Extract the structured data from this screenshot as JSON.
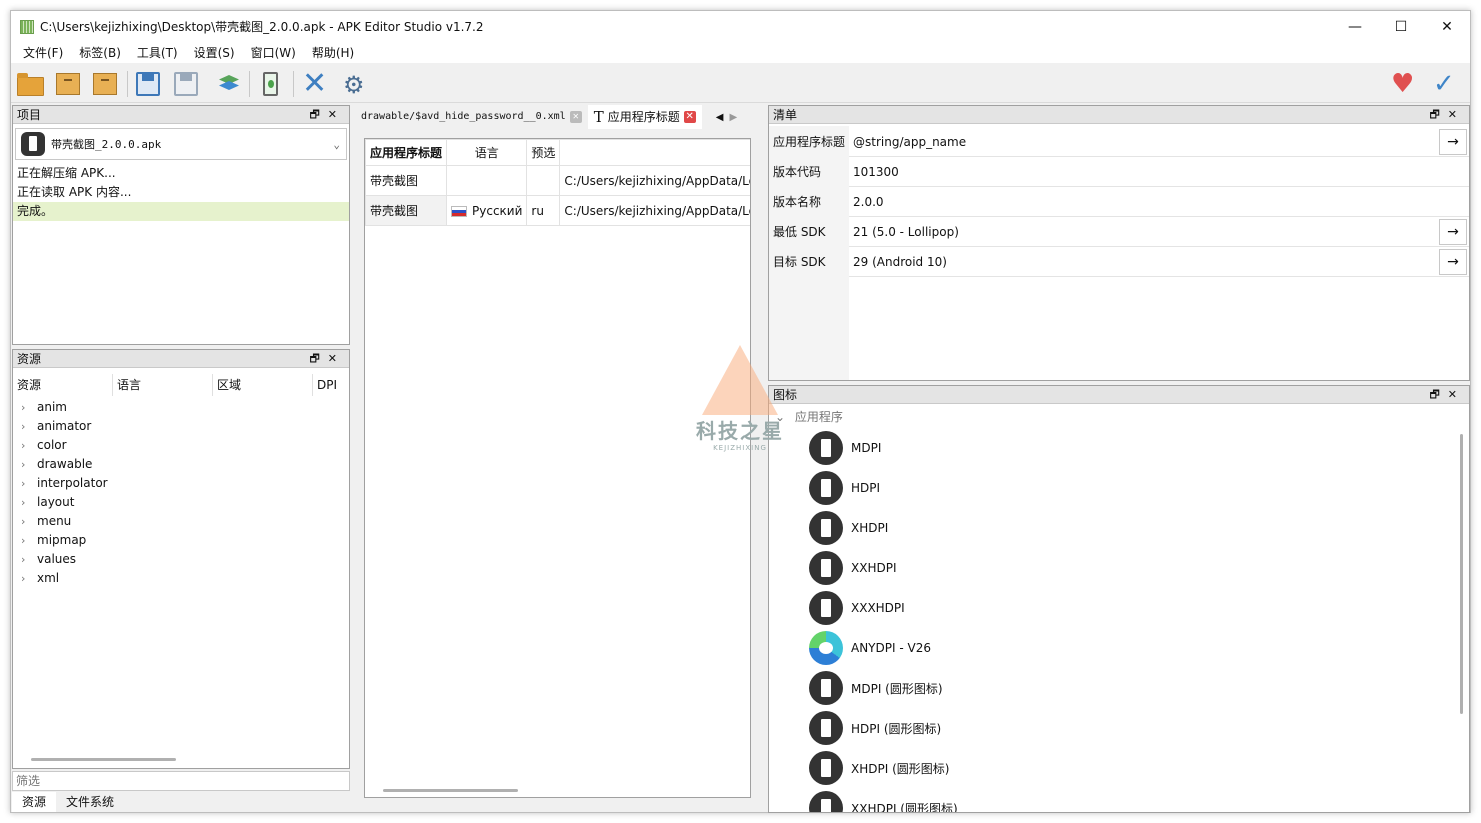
{
  "window": {
    "title": "C:\\Users\\kejizhixing\\Desktop\\带壳截图_2.0.0.apk - APK Editor Studio v1.7.2",
    "minimize": "—",
    "maximize": "☐",
    "close": "✕"
  },
  "menu": [
    "文件(F)",
    "标签(B)",
    "工具(T)",
    "设置(S)",
    "窗口(W)",
    "帮助(H)"
  ],
  "toolbar": {
    "icons": [
      "open-folder",
      "open-package",
      "install-package",
      "save",
      "save-as",
      "layers",
      "device",
      "close",
      "settings",
      "donate-heart",
      "update-check"
    ]
  },
  "project_panel": {
    "title": "项目",
    "apk": "带壳截图_2.0.0.apk",
    "log": [
      "正在解压缩 APK...",
      "正在读取 APK 内容...",
      "完成。"
    ]
  },
  "resources_panel": {
    "title": "资源",
    "columns": [
      "资源",
      "语言",
      "区域",
      "DPI"
    ],
    "items": [
      "anim",
      "animator",
      "color",
      "drawable",
      "interpolator",
      "layout",
      "menu",
      "mipmap",
      "values",
      "xml"
    ],
    "filter_placeholder": "筛选",
    "bottom_tabs": [
      "资源",
      "文件系统"
    ]
  },
  "editor": {
    "tabs": [
      {
        "label": "drawable/$avd_hide_password__0.xml",
        "active": false
      },
      {
        "label": "应用程序标题",
        "active": true
      }
    ],
    "table": {
      "headers": [
        "应用程序标题",
        "语言",
        "预选",
        ""
      ],
      "rows": [
        [
          "带壳截图",
          "",
          "",
          "C:/Users/kejizhixing/AppData/Lo"
        ],
        [
          "带壳截图",
          "Русский",
          "ru",
          "C:/Users/kejizhixing/AppData/Lo"
        ]
      ]
    }
  },
  "manifest_panel": {
    "title": "清单",
    "rows": [
      {
        "label": "应用程序标题",
        "value": "@string/app_name",
        "arrow": "→"
      },
      {
        "label": "版本代码",
        "value": "101300",
        "arrow": ""
      },
      {
        "label": "版本名称",
        "value": "2.0.0",
        "arrow": ""
      },
      {
        "label": "最低 SDK",
        "value": "21 (5.0 - Lollipop)",
        "arrow": "→"
      },
      {
        "label": "目标 SDK",
        "value": "29 (Android 10)",
        "arrow": "→"
      }
    ]
  },
  "icons_panel": {
    "title": "图标",
    "group": "应用程序",
    "items": [
      "MDPI",
      "HDPI",
      "XHDPI",
      "XXHDPI",
      "XXXHDPI",
      "ANYDPI - V26",
      "MDPI (圆形图标)",
      "HDPI (圆形图标)",
      "XHDPI (圆形图标)",
      "XXHDPI (圆形图标)"
    ]
  },
  "watermark": {
    "text": "科技之星",
    "sub": "KEJIZHIXING"
  }
}
